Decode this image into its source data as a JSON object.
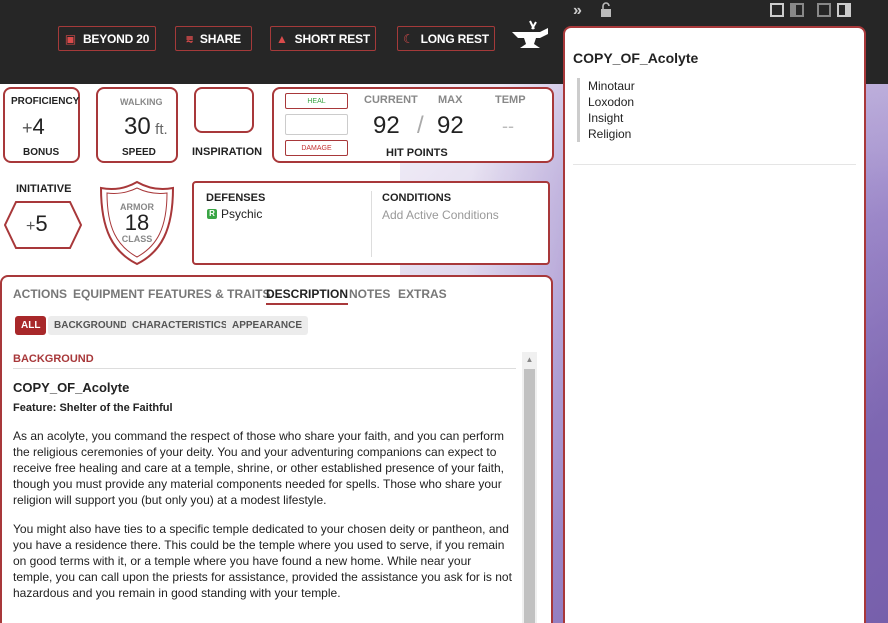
{
  "toolbar": {
    "beyond20": "BEYOND 20",
    "share": "SHARE",
    "short_rest": "SHORT REST",
    "long_rest": "LONG REST"
  },
  "stats": {
    "proficiency_label": "PROFICIENCY",
    "proficiency_sign": "+",
    "proficiency_value": "4",
    "proficiency_sub": "BONUS",
    "walking_label": "WALKING",
    "speed_value": "30",
    "speed_unit": "ft.",
    "speed_sub": "SPEED",
    "inspiration_label": "INSPIRATION",
    "initiative_label": "INITIATIVE",
    "initiative_sign": "+",
    "initiative_value": "5",
    "armor_top": "ARMOR",
    "armor_value": "18",
    "armor_bottom": "CLASS"
  },
  "hp": {
    "heal": "HEAL",
    "damage": "DAMAGE",
    "current_label": "CURRENT",
    "max_label": "MAX",
    "temp_label": "TEMP",
    "current": "92",
    "separator": "/",
    "max": "92",
    "temp": "--",
    "title": "HIT POINTS"
  },
  "defenses": {
    "title": "DEFENSES",
    "badge": "R",
    "item": "Psychic"
  },
  "conditions": {
    "title": "CONDITIONS",
    "placeholder": "Add Active Conditions"
  },
  "tabs": [
    "ACTIONS",
    "EQUIPMENT",
    "FEATURES & TRAITS",
    "DESCRIPTION",
    "NOTES",
    "EXTRAS"
  ],
  "filters": [
    "ALL",
    "BACKGROUND",
    "CHARACTERISTICS",
    "APPEARANCE"
  ],
  "description": {
    "section_title": "BACKGROUND",
    "background_name": "COPY_OF_Acolyte",
    "feature": "Feature: Shelter of the Faithful",
    "para1": "As an acolyte, you command the respect of those who share your faith, and you can perform the religious ceremonies of your deity. You and your adventuring companions can expect to receive free healing and care at a temple, shrine, or other established presence of your faith, though you must provide any material components needed for spells. Those who share your religion will support you (but only you) at a modest lifestyle.",
    "para2": "You might also have ties to a specific temple dedicated to your chosen deity or pantheon, and you have a residence there. This could be the temple where you used to serve, if you remain on good terms with it, or a temple where you have found a new home. While near your temple, you can call upon the priests for assistance, provided the assistance you ask for is not hazardous and you remain in good standing with your temple."
  },
  "side_panel": {
    "title": "COPY_OF_Acolyte",
    "items": [
      "Minotaur",
      "Loxodon",
      "Insight",
      "Religion"
    ]
  },
  "colors": {
    "accent": "#a8383a",
    "topbar": "#262626"
  }
}
